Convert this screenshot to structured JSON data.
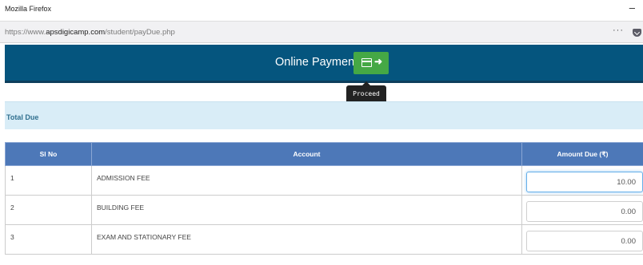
{
  "window": {
    "title": "Mozilla Firefox",
    "minimize": "–"
  },
  "browser": {
    "url_prefix": "https://www.",
    "url_domain": "apsdigicamp.com",
    "url_path": "/student/payDue.php",
    "menu": "···"
  },
  "header": {
    "title": "Online Payment",
    "proceed_tooltip": "Proceed"
  },
  "total_due": {
    "label": "Total Due"
  },
  "table": {
    "headers": [
      "Sl No",
      "Account",
      "Amount Due (₹)"
    ],
    "rows": [
      {
        "sl": "1",
        "account": "ADMISSION FEE",
        "amount": "10.00"
      },
      {
        "sl": "2",
        "account": "BUILDING FEE",
        "amount": "0.00"
      },
      {
        "sl": "3",
        "account": "EXAM AND STATIONARY FEE",
        "amount": "0.00"
      }
    ]
  },
  "colors": {
    "header_bg": "#05557e",
    "pay_button": "#45a845",
    "table_header": "#4d78b8",
    "total_due_bg": "#d9edf7",
    "tooltip_accent": "#d1206f"
  }
}
